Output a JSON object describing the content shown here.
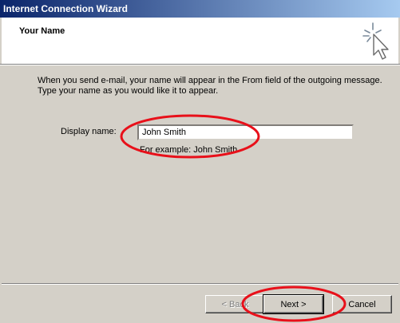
{
  "window": {
    "title": "Internet Connection Wizard"
  },
  "header": {
    "heading": "Your Name",
    "icon": "wizard-sparkle-cursor-icon"
  },
  "instructions": {
    "line1": "When you send e-mail, your name will appear in the From field of the outgoing message.",
    "line2": "Type your name as you would like it to appear."
  },
  "form": {
    "display_name_label": "Display name:",
    "display_name_value": "John Smith",
    "example_text": "For example: John Smith"
  },
  "buttons": {
    "back_label": "< Back",
    "next_label": "Next >",
    "cancel_label": "Cancel"
  },
  "colors": {
    "title_gradient_start": "#0a246a",
    "title_gradient_end": "#a6caf0",
    "dialog_background": "#d4d0c8",
    "annotation_red": "#e8101a"
  }
}
